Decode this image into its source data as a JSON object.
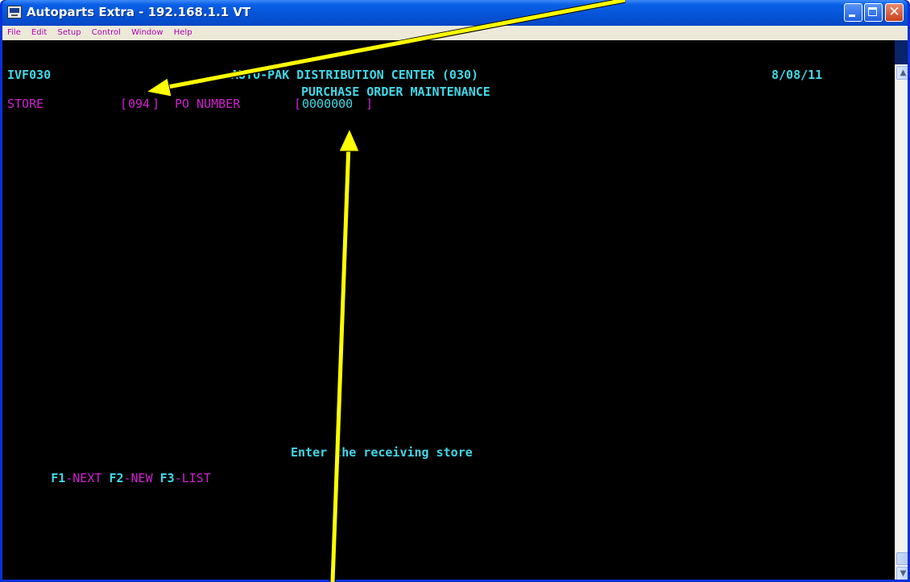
{
  "window": {
    "title": "Autoparts Extra - 192.168.1.1 VT"
  },
  "menu": {
    "items": [
      "File",
      "Edit",
      "Setup",
      "Control",
      "Window",
      "Help"
    ]
  },
  "terminal": {
    "program_id": "IVF030",
    "center_title": "AUTO-PAK DISTRIBUTION CENTER (030)",
    "date": "8/08/11",
    "screen_title": "PURCHASE ORDER MAINTENANCE",
    "store_label": "STORE",
    "store_open": "[",
    "store_value": "094",
    "store_close": "]",
    "po_label": "PO NUMBER",
    "po_open": "[",
    "po_value": "0000000",
    "po_close": " ]",
    "prompt": "Enter the receiving store",
    "function_keys": [
      {
        "key": "F1",
        "label": "-NEXT"
      },
      {
        "key": "F2",
        "label": "-NEW"
      },
      {
        "key": "F3",
        "label": "-LIST"
      }
    ]
  },
  "colors": {
    "terminal_bg": "#000000",
    "cyan": "#3fd8e8",
    "magenta": "#d020d0",
    "arrow": "#ffff00"
  },
  "icons": {
    "app": "terminal-app-icon",
    "minimize": "minimize-icon",
    "maximize": "maximize-icon",
    "close": "close-icon",
    "scroll_up": "chevron-up-icon",
    "scroll_down": "chevron-down-icon"
  }
}
